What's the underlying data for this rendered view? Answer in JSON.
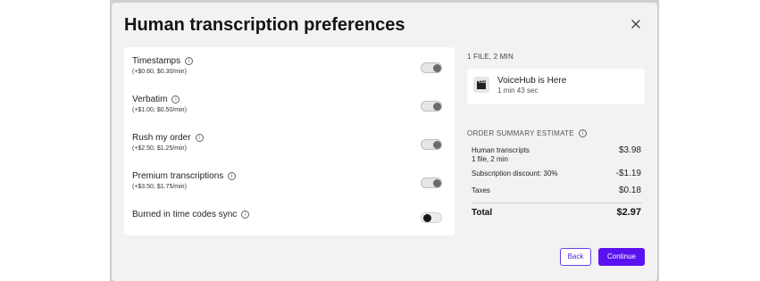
{
  "dialog": {
    "title": "Human transcription preferences",
    "close_icon": "close-icon"
  },
  "options": [
    {
      "label": "Timestamps",
      "price": "(+$0.60, $0.30/min)",
      "enabled": false
    },
    {
      "label": "Verbatim",
      "price": "(+$1.00, $0.50/min)",
      "enabled": false
    },
    {
      "label": "Rush my order",
      "price": "(+$2.50, $1.25/min)",
      "enabled": false
    },
    {
      "label": "Premium transcriptions",
      "price": "(+$3.50, $1.75/min)",
      "enabled": false
    },
    {
      "label": "Burned in time codes sync",
      "price": "",
      "enabled": false
    }
  ],
  "info_glyph": "i",
  "files": {
    "count_label": "1 FILE, 2 MIN",
    "items": [
      {
        "name": "VoiceHub is Here",
        "duration": "1 min 43 sec",
        "icon": "clapperboard-icon"
      }
    ]
  },
  "summary": {
    "heading": "ORDER SUMMARY ESTIMATE",
    "rows": [
      {
        "label": "Human transcripts",
        "sublabel": "1 file, 2 min",
        "value": "$3.98"
      },
      {
        "label": "Subscription discount: 30%",
        "value": "-$1.19"
      },
      {
        "label": "Taxes",
        "value": "$0.18"
      }
    ],
    "total_label": "Total",
    "total_value": "$2.97"
  },
  "buttons": {
    "back": "Back",
    "continue": "Continue"
  },
  "colors": {
    "accent": "#5b12f0",
    "panel": "#ffffff",
    "dialog_bg": "#f2f2f2"
  }
}
